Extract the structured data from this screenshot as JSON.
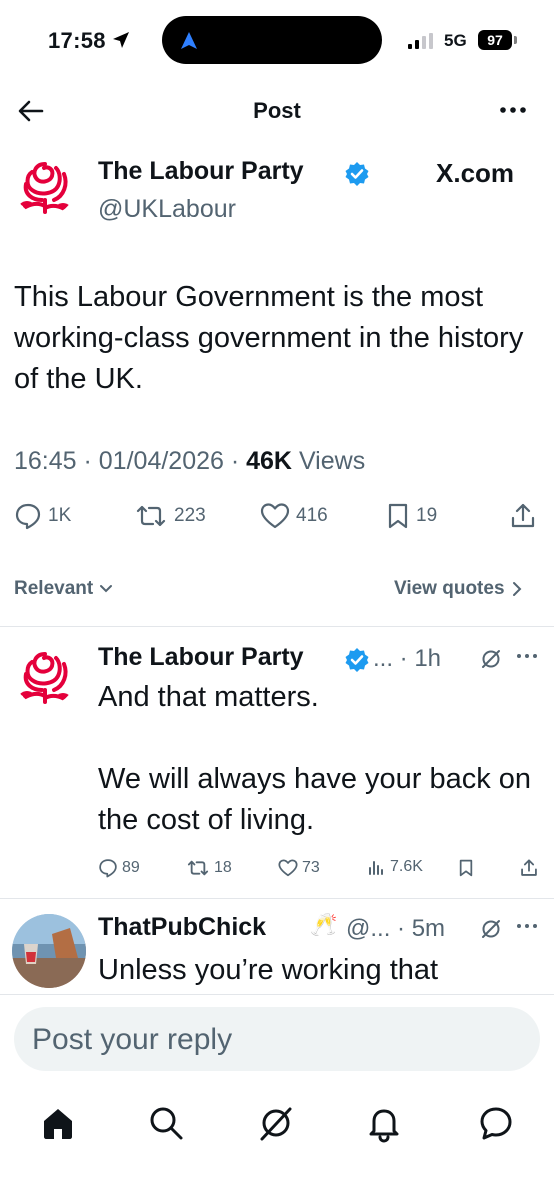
{
  "status_bar": {
    "time": "17:58",
    "network": "5G",
    "battery": "97",
    "icons": [
      "location-arrow-icon",
      "navigation-icon",
      "signal-icon"
    ]
  },
  "header": {
    "title": "Post",
    "icons": [
      "back-arrow-icon",
      "more-dots-icon"
    ]
  },
  "main_post": {
    "author_name": "The Labour Party",
    "handle": "@UKLabour",
    "source_label": "X.com",
    "text": "This Labour Government is the most working-class government in the history of the UK.",
    "time": "16:45",
    "date": "01/04/2026",
    "views_count": "46K",
    "views_label": "Views",
    "actions": {
      "replies": "1K",
      "reposts": "223",
      "likes": "416",
      "bookmarks": "19"
    }
  },
  "filter": {
    "sort_label": "Relevant",
    "view_quotes_label": "View quotes"
  },
  "replies": [
    {
      "author_name": "The Labour Party",
      "meta": "... · 1h",
      "text": "And that matters.\n\nWe will always have your back on the cost of living.",
      "actions": {
        "replies": "89",
        "reposts": "18",
        "likes": "73",
        "views": "7.6K"
      }
    },
    {
      "author_name": "ThatPubChick",
      "emoji": "🥂",
      "meta": "@... · 5m",
      "text": "Unless you’re working that"
    }
  ],
  "composer": {
    "placeholder": "Post your reply"
  },
  "colors": {
    "text": "#0f1419",
    "secondary": "#536471",
    "verified": "#1d9bf0",
    "labour_red": "#e4003b",
    "divider": "#e3e6ea",
    "composer_bg": "#eff3f4"
  },
  "bottom_nav": [
    "home-icon",
    "search-icon",
    "grok-icon",
    "notifications-bell-icon",
    "messages-icon"
  ]
}
